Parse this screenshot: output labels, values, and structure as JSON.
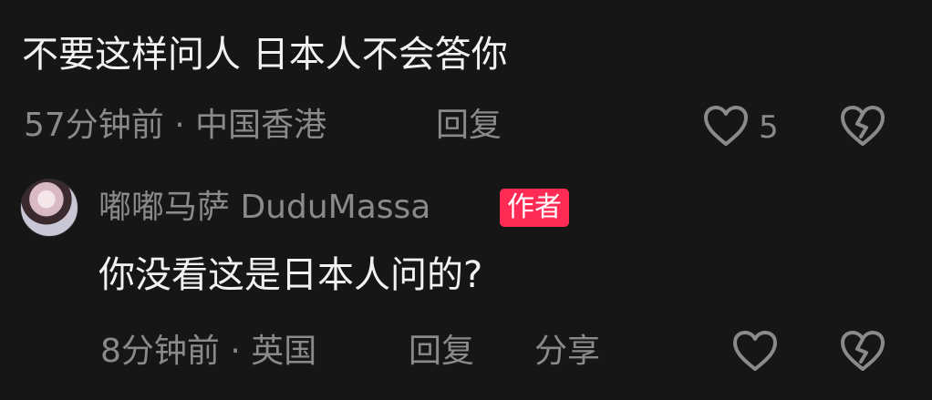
{
  "comment1": {
    "text": "不要这样问人 日本人不会答你",
    "meta": "57分钟前 · 中国香港",
    "reply_label": "回复",
    "like_count": "5"
  },
  "reply1": {
    "username": "嘟嘟马萨 DuduMassa",
    "author_badge": "作者",
    "text": "你没看这是日本人问的?",
    "meta": "8分钟前 · 英国",
    "reply_label": "回复",
    "share_label": "分享"
  },
  "icons": {
    "like": "heart-outline-icon",
    "dislike": "broken-heart-icon"
  },
  "colors": {
    "background": "#161616",
    "text_primary": "#f2f2f2",
    "text_secondary": "#8a8a8a",
    "badge": "#fe2c55"
  }
}
